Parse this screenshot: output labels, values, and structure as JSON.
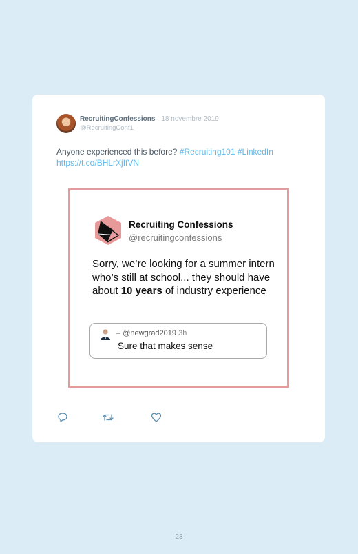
{
  "tweet": {
    "author_name": "RecruitingConfessions",
    "date": "· 18 novembre 2019",
    "handle": "@RecruitingConf1",
    "text": "Anyone experienced this before?",
    "hashtags": [
      "#Recruiting101",
      "#LinkedIn"
    ],
    "link": "https://t.co/BHLrXjIfVN"
  },
  "quote": {
    "name": "Recruiting Confessions",
    "handle": "@recruitingconfessions",
    "body_before": "Sorry, we’re looking for a summer intern who’s still at school... they should have about ",
    "body_bold": "10 years",
    "body_after": " of industry experience",
    "reply": {
      "dash": "–",
      "handle": "@newgrad2019",
      "time": "3h",
      "text": "Sure that makes sense"
    }
  },
  "actions": {
    "reply_icon": "comment-icon",
    "retweet_icon": "retweet-icon",
    "like_icon": "heart-icon"
  },
  "colors": {
    "background": "#dcecf6",
    "link": "#5fb8ea",
    "frame": "#e39b9c",
    "logo": "#e8999a"
  },
  "page_number": "23"
}
